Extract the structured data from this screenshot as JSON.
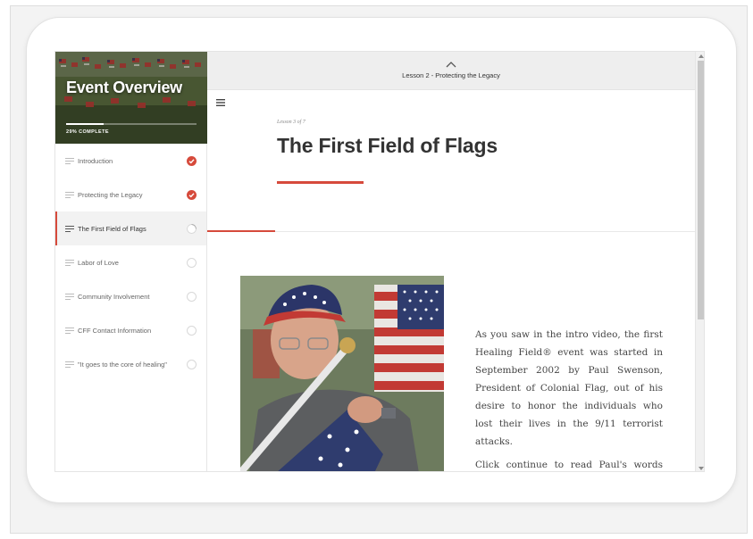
{
  "sidebar": {
    "title": "Event Overview",
    "progress_label": "29% COMPLETE",
    "progress_fraction": 0.29,
    "items": [
      {
        "label": "Introduction",
        "status": "complete"
      },
      {
        "label": "Protecting the Legacy",
        "status": "complete"
      },
      {
        "label": "The First Field of Flags",
        "status": "in-progress"
      },
      {
        "label": "Labor of Love",
        "status": "not-started"
      },
      {
        "label": "Community Involvement",
        "status": "not-started"
      },
      {
        "label": "CFF Contact Information",
        "status": "not-started"
      },
      {
        "label": "\"It goes to the core of healing\"",
        "status": "not-started"
      }
    ]
  },
  "topbar": {
    "previous_lesson": "Lesson 2 - Protecting the Legacy"
  },
  "lesson": {
    "counter": "Lesson 3 of 7",
    "title": "The First Field of Flags",
    "paragraphs": [
      "As you saw in the intro video, the first Healing Field® event was started in September 2002 by Paul Swenson, President of Colonial Flag, out of his desire to honor the individuals who lost their lives in the 9/11 terrorist attacks.",
      "Click continue to read Paul's words about the first event."
    ]
  },
  "colors": {
    "accent": "#d64a3b",
    "topbar_bg": "#eeeeee",
    "active_item_bg": "#f2f2f2"
  },
  "icons": {
    "lesson_item": "list-lines-icon",
    "complete": "check-circle-icon",
    "in_progress": "partial-circle-icon",
    "not_started": "empty-circle-icon",
    "previous": "chevron-up-icon",
    "menu": "hamburger-menu-icon"
  }
}
